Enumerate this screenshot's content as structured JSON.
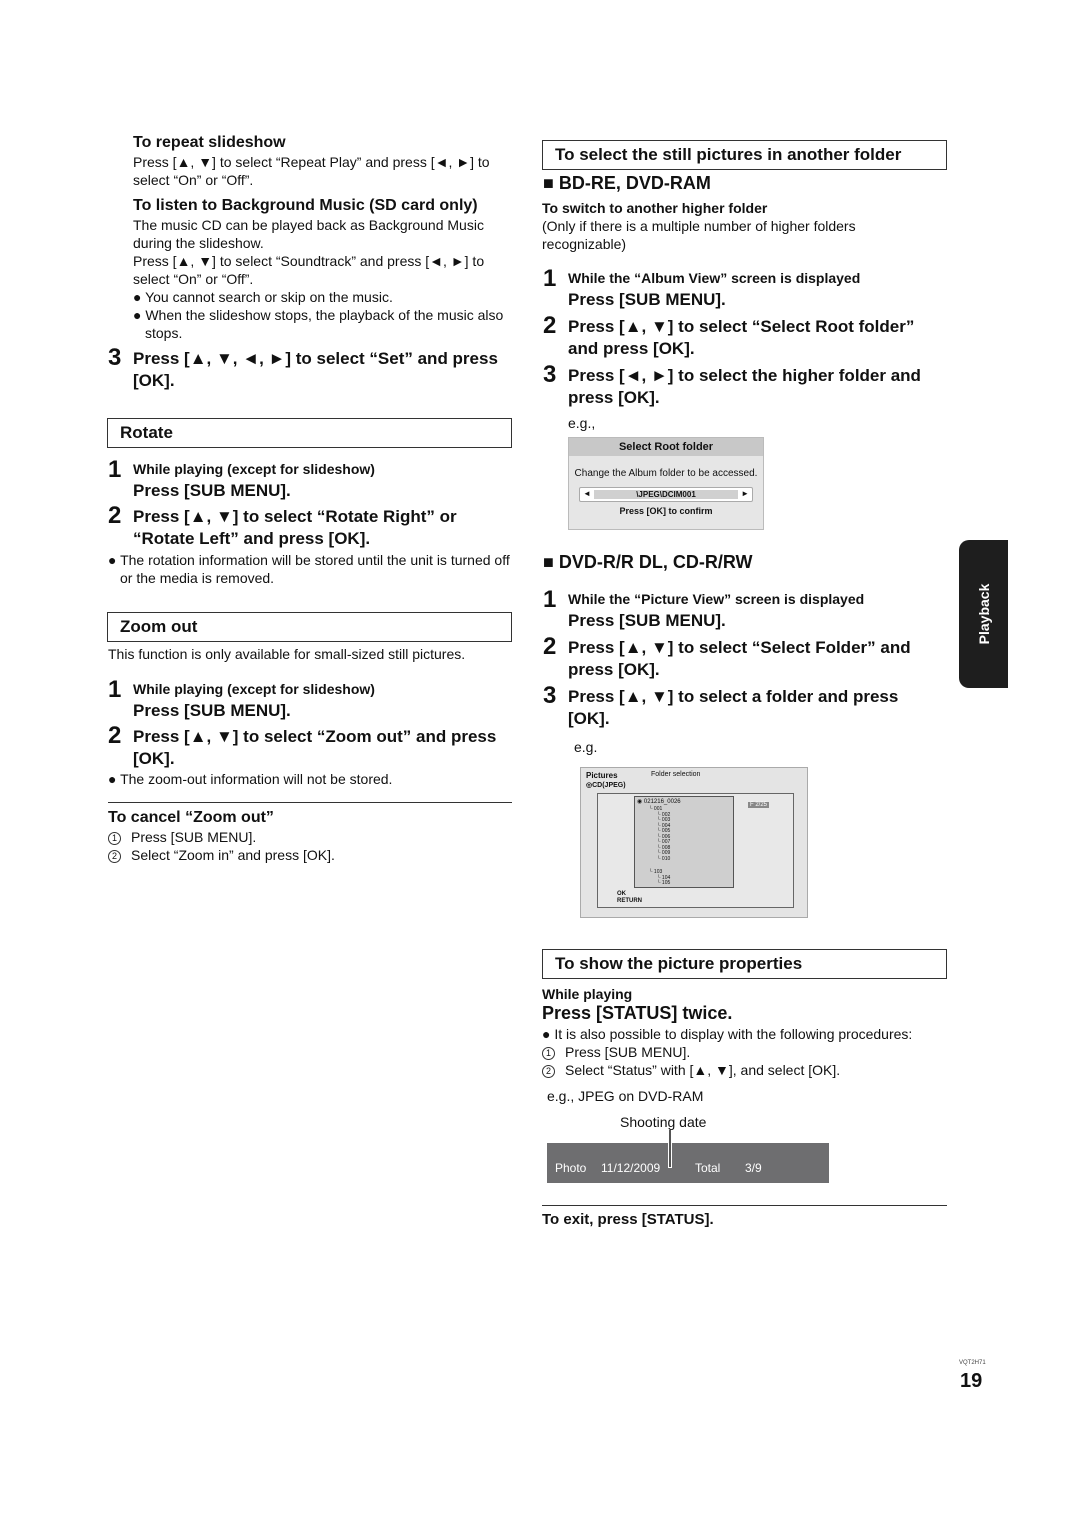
{
  "left": {
    "repeat": {
      "title": "To repeat slideshow",
      "body": "Press [▲, ▼] to select “Repeat Play” and press [◄, ►] to select “On” or “Off”."
    },
    "bgm": {
      "title": "To listen to Background Music (SD card only)",
      "body1": "The music CD can be played back as Background Music during the slideshow.",
      "body2": "Press [▲, ▼] to select “Soundtrack” and press [◄, ►] to select “On” or “Off”.",
      "bullets": [
        "● You cannot search or skip on the music.",
        "● When the slideshow stops, the playback of the music also stops."
      ]
    },
    "step3": {
      "num": "3",
      "text": "Press [▲, ▼, ◄, ►] to select “Set” and press [OK]."
    },
    "rotate": {
      "header": "Rotate",
      "step1": {
        "num": "1",
        "sub": "While playing (except for slideshow)",
        "text": "Press [SUB MENU]."
      },
      "step2": {
        "num": "2",
        "text": "Press [▲, ▼] to select “Rotate Right” or “Rotate Left” and press [OK]."
      },
      "note": "● The rotation information will be stored until the unit is turned off or the media is removed."
    },
    "zoom": {
      "header": "Zoom out",
      "intro": "This function is only available for small-sized still pictures.",
      "step1": {
        "num": "1",
        "sub": "While playing (except for slideshow)",
        "text": "Press [SUB MENU]."
      },
      "step2": {
        "num": "2",
        "text": "Press [▲, ▼] to select “Zoom out” and press [OK]."
      },
      "note": "● The zoom-out information will not be stored.",
      "cancel": {
        "title": "To cancel “Zoom out”",
        "items": [
          {
            "n": "1",
            "text": "Press [SUB MENU]."
          },
          {
            "n": "2",
            "text": "Select “Zoom in” and press [OK]."
          }
        ]
      }
    }
  },
  "right": {
    "folder": {
      "header": "To select the still pictures in another folder",
      "section1": "■  BD-RE, DVD-RAM",
      "sub_title": "To switch to another higher folder",
      "sub_body": "(Only if there is a multiple number of higher folders recognizable)",
      "steps1": [
        {
          "num": "1",
          "sub": "While the “Album View” screen is displayed",
          "text": "Press [SUB MENU]."
        },
        {
          "num": "2",
          "text": "Press [▲, ▼] to select “Select Root folder” and press [OK]."
        },
        {
          "num": "3",
          "text": "Press [◄, ►] to select the higher folder and press [OK]."
        }
      ],
      "eg1": "e.g.,",
      "screen1": {
        "title": "Select Root folder",
        "message": "Change the Album folder to be accessed.",
        "path": "\\JPEG\\DCIM001",
        "confirm": "Press [OK] to confirm"
      },
      "section2": "■  DVD-R/R DL, CD-R/RW",
      "steps2": [
        {
          "num": "1",
          "sub": "While the “Picture View” screen is displayed",
          "text": "Press [SUB MENU]."
        },
        {
          "num": "2",
          "text": "Press [▲, ▼] to select “Select Folder” and press [OK]."
        },
        {
          "num": "3",
          "text": "Press [▲, ▼] to select a folder and press [OK]."
        }
      ],
      "eg2": "e.g.",
      "screen2": {
        "title": "Pictures",
        "media": "◎CD(JPEG)",
        "heading": "Folder selection",
        "root": "021216_0026",
        "tree": [
          "001",
          "002",
          "003",
          "004",
          "005",
          "006",
          "007",
          "008",
          "009",
          "010",
          "103",
          "104",
          "105"
        ],
        "counter": "F  2/25",
        "ok": "OK",
        "return": "RETURN"
      }
    },
    "properties": {
      "header": "To show the picture properties",
      "while": "While playing",
      "press": "Press [STATUS] twice.",
      "bullet": "● It is also possible to display with the following procedures:",
      "items": [
        {
          "n": "1",
          "text": "Press [SUB MENU]."
        },
        {
          "n": "2",
          "text": "Select “Status” with [▲, ▼], and select [OK]."
        }
      ],
      "eg": "e.g., JPEG on DVD-RAM",
      "callout": "Shooting date",
      "bar": {
        "type": "Photo",
        "date": "11/12/2009",
        "total_label": "Total",
        "total": "3/9"
      },
      "exit": "To exit, press [STATUS]."
    }
  },
  "side_tab": "Playback",
  "footer": {
    "code": "VQT2H71",
    "page": "19"
  }
}
